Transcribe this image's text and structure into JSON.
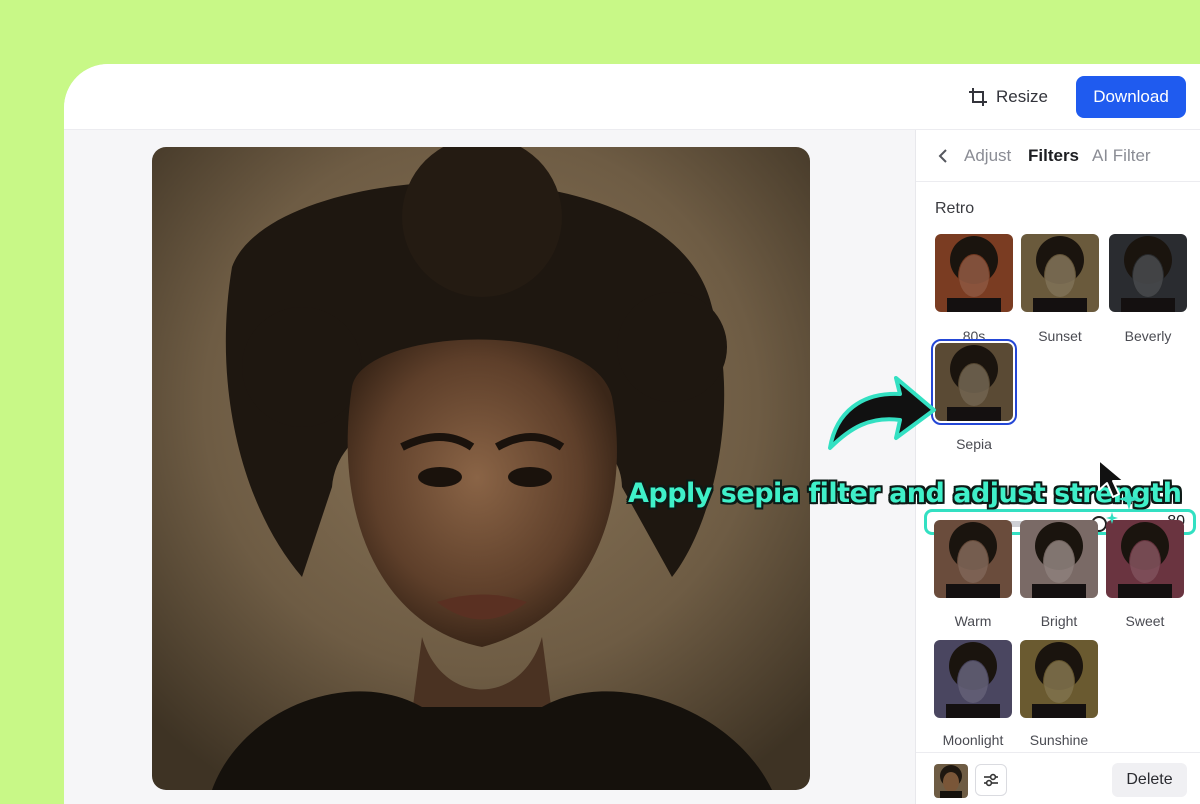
{
  "toolbar": {
    "resize_label": "Resize",
    "download_label": "Download"
  },
  "panel": {
    "tabs": [
      {
        "label": "Adjust",
        "active": false
      },
      {
        "label": "Filters",
        "active": true
      },
      {
        "label": "AI Filter",
        "active": false
      }
    ],
    "section_title": "Retro",
    "filters": [
      {
        "label": "80s",
        "tone": "#7a3c22"
      },
      {
        "label": "Sunset",
        "tone": "#6a5a3c"
      },
      {
        "label": "Beverly",
        "tone": "#2a2c30"
      },
      {
        "label": "Sepia",
        "tone": "#5a4a34",
        "selected": true
      },
      {
        "label": "Warm",
        "tone": "#6a4c3c"
      },
      {
        "label": "Bright",
        "tone": "#7a6a66"
      },
      {
        "label": "Sweet",
        "tone": "#6a3440"
      },
      {
        "label": "Moonlight",
        "tone": "#4a4660"
      },
      {
        "label": "Sunshine",
        "tone": "#6a5a30"
      }
    ],
    "strength": {
      "value": 80,
      "fraction": 0.8
    },
    "delete_label": "Delete"
  },
  "annotation": {
    "text": "Apply sepia filter and adjust strength"
  },
  "colors": {
    "background": "#c8f887",
    "accent": "#1f5bef",
    "highlight": "#33e0c2"
  }
}
